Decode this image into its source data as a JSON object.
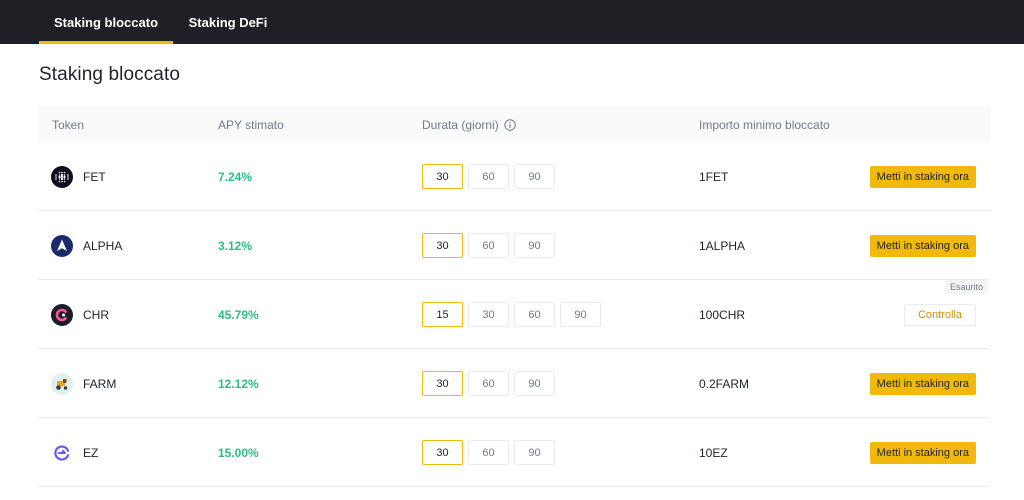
{
  "tabs": [
    {
      "label": "Staking bloccato",
      "active": true
    },
    {
      "label": "Staking DeFi",
      "active": false
    }
  ],
  "page_title": "Staking bloccato",
  "colors": {
    "accent": "#f0b90b",
    "apy_green": "#2ebd85",
    "topbar": "#1e2026",
    "check_text": "#c99400"
  },
  "table": {
    "headers": {
      "token": "Token",
      "apy": "APY stimato",
      "duration": "Durata (giorni)",
      "min_amount": "Importo minimo bloccato"
    },
    "rows": [
      {
        "icon": "fet-coin-icon",
        "symbol": "FET",
        "apy": "7.24%",
        "durations": [
          "30",
          "60",
          "90"
        ],
        "selected": "30",
        "min_amount": "1FET",
        "action": "Metti in staking ora",
        "sold_out": false
      },
      {
        "icon": "alpha-coin-icon",
        "symbol": "ALPHA",
        "apy": "3.12%",
        "durations": [
          "30",
          "60",
          "90"
        ],
        "selected": "30",
        "min_amount": "1ALPHA",
        "action": "Metti in staking ora",
        "sold_out": false
      },
      {
        "icon": "chr-coin-icon",
        "symbol": "CHR",
        "apy": "45.79%",
        "durations": [
          "15",
          "30",
          "60",
          "90"
        ],
        "selected": "15",
        "min_amount": "100CHR",
        "action": "Controlla",
        "sold_out": true,
        "sold_out_label": "Esaurito"
      },
      {
        "icon": "farm-coin-icon",
        "symbol": "FARM",
        "apy": "12.12%",
        "durations": [
          "30",
          "60",
          "90"
        ],
        "selected": "30",
        "min_amount": "0.2FARM",
        "action": "Metti in staking ora",
        "sold_out": false
      },
      {
        "icon": "ez-coin-icon",
        "symbol": "EZ",
        "apy": "15.00%",
        "durations": [
          "30",
          "60",
          "90"
        ],
        "selected": "30",
        "min_amount": "10EZ",
        "action": "Metti in staking ora",
        "sold_out": false
      }
    ]
  }
}
